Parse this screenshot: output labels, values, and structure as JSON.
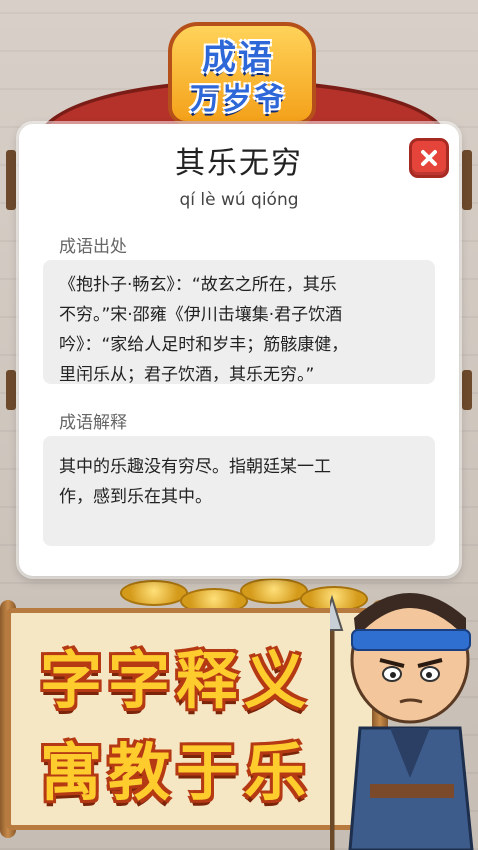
{
  "logo": {
    "line1": "成语",
    "line2": "万岁爷"
  },
  "idiom": {
    "title": "其乐无穷",
    "pinyin": "qí lè wú qióng"
  },
  "source": {
    "label": "成语出处",
    "lines": [
      "《抱扑子·畅玄》：“故玄之所在，其乐",
      "不穷。”宋·邵雍《伊川击壤集·君子饮酒",
      "吟》：“家给人足时和岁丰；筋骸康健，",
      "里闬乐从；君子饮酒，其乐无穷。”"
    ]
  },
  "explanation": {
    "label": "成语解释",
    "lines": [
      "其中的乐趣没有穷尽。指朝廷某一工",
      "作，感到乐在其中。"
    ]
  },
  "banner": {
    "line1": "字字释义",
    "line2": "寓教于乐"
  },
  "colors": {
    "close_button": "#e4443a",
    "card_bg": "#ffffff",
    "section_bg": "#eeeeee",
    "slogan": "#ffcc2e"
  }
}
